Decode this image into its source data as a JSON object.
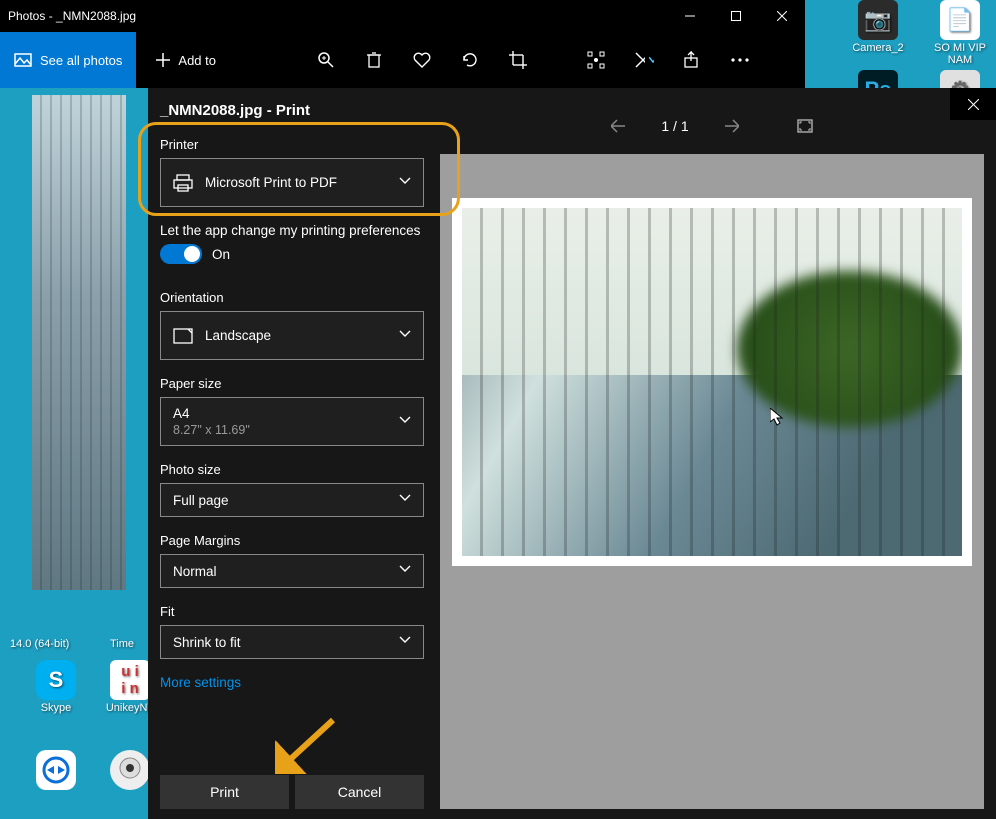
{
  "window": {
    "title": "Photos - _NMN2088.jpg",
    "see_all": "See all photos",
    "add_to": "Add to"
  },
  "desktop": {
    "camera": "Camera_2",
    "somi": "SO MI VIP NAM",
    "ps": "Ps",
    "skype": "Skype",
    "unikey": "UnikeyNT",
    "bglabel1": "14.0 (64-bit)",
    "bglabel2": "Time"
  },
  "dialog": {
    "title": "_NMN2088.jpg - Print",
    "printer_label": "Printer",
    "printer_value": "Microsoft Print to PDF",
    "pref_text": "Let the app change my printing preferences",
    "toggle_on": "On",
    "orientation_label": "Orientation",
    "orientation_value": "Landscape",
    "paper_label": "Paper size",
    "paper_value": "A4",
    "paper_sub": "8.27\" x 11.69\"",
    "photo_size_label": "Photo size",
    "photo_size_value": "Full page",
    "margins_label": "Page Margins",
    "margins_value": "Normal",
    "fit_label": "Fit",
    "fit_value": "Shrink to fit",
    "more": "More settings",
    "print_btn": "Print",
    "cancel_btn": "Cancel",
    "page_info": "1  /  1"
  }
}
